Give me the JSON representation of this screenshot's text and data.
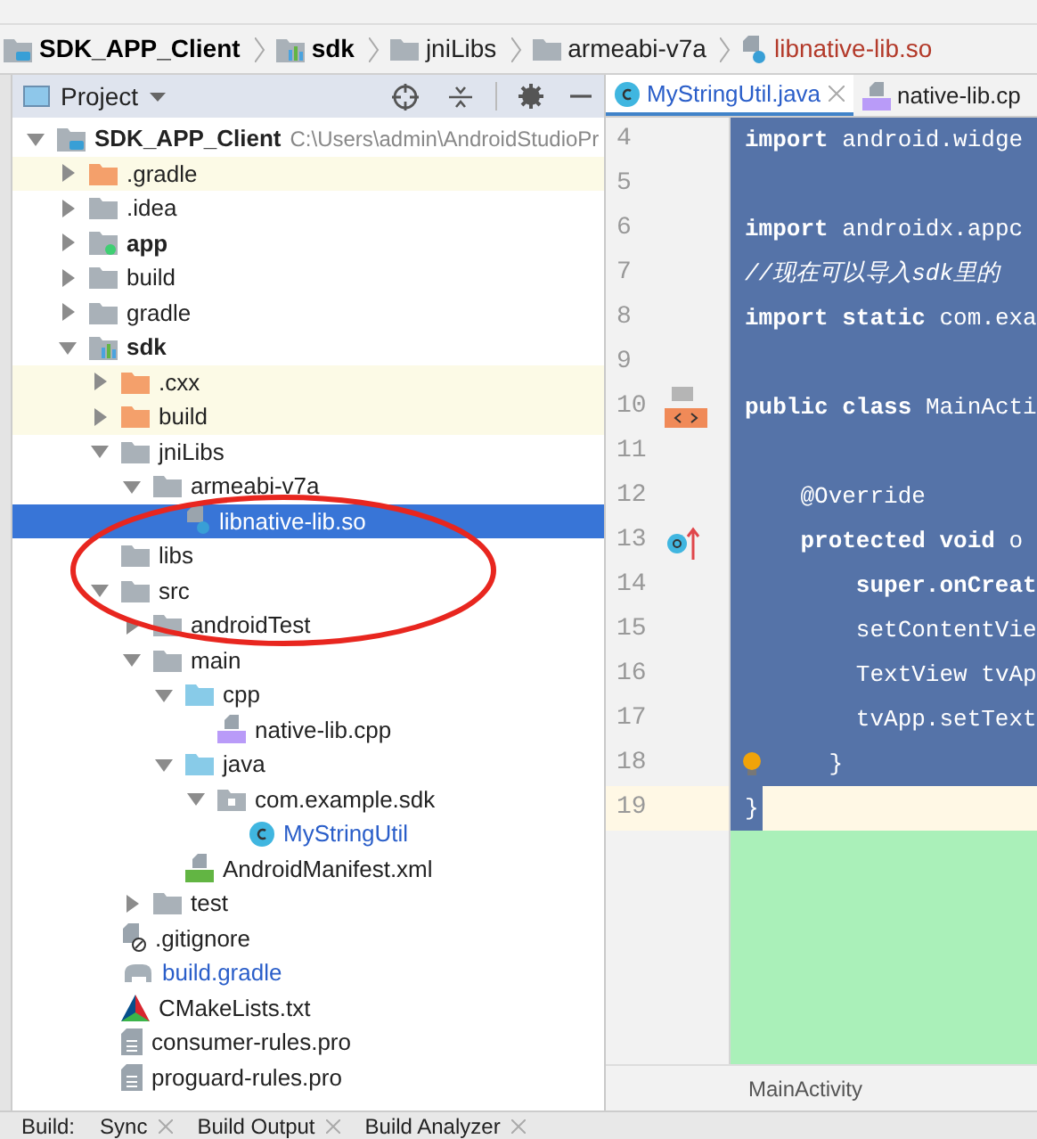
{
  "breadcrumb": [
    {
      "label": "SDK_APP_Client",
      "kind": "project"
    },
    {
      "label": "sdk",
      "kind": "module"
    },
    {
      "label": "jniLibs",
      "kind": "folder"
    },
    {
      "label": "armeabi-v7a",
      "kind": "folder"
    },
    {
      "label": "libnative-lib.so",
      "kind": "unknown"
    }
  ],
  "project_panel": {
    "title": "Project",
    "tree": [
      {
        "label": "SDK_APP_Client",
        "path": "C:\\Users\\admin\\AndroidStudioPr",
        "kind": "project",
        "expanded": true,
        "selected": false,
        "excluded": false,
        "children": [
          {
            "label": ".gradle",
            "kind": "folder-orange",
            "expanded": false,
            "selected": false,
            "excluded": true
          },
          {
            "label": ".idea",
            "kind": "folder",
            "expanded": false,
            "selected": false,
            "excluded": false
          },
          {
            "label": "app",
            "kind": "module-app",
            "expanded": false,
            "selected": false,
            "excluded": false
          },
          {
            "label": "build",
            "kind": "folder",
            "expanded": false,
            "selected": false,
            "excluded": false
          },
          {
            "label": "gradle",
            "kind": "folder",
            "expanded": false,
            "selected": false,
            "excluded": false
          },
          {
            "label": "sdk",
            "kind": "module",
            "expanded": true,
            "selected": false,
            "excluded": false,
            "children": [
              {
                "label": ".cxx",
                "kind": "folder-orange",
                "expanded": false,
                "selected": false,
                "excluded": true
              },
              {
                "label": "build",
                "kind": "folder-orange",
                "expanded": false,
                "selected": false,
                "excluded": true
              },
              {
                "label": "jniLibs",
                "kind": "folder",
                "expanded": true,
                "selected": false,
                "excluded": false,
                "children": [
                  {
                    "label": "armeabi-v7a",
                    "kind": "folder",
                    "expanded": true,
                    "selected": false,
                    "excluded": false,
                    "children": [
                      {
                        "label": "libnative-lib.so",
                        "kind": "unknown",
                        "selected": true
                      }
                    ]
                  }
                ]
              },
              {
                "label": "libs",
                "kind": "folder",
                "selected": false,
                "excluded": false
              },
              {
                "label": "src",
                "kind": "folder",
                "expanded": true,
                "selected": false,
                "excluded": false,
                "children": [
                  {
                    "label": "androidTest",
                    "kind": "folder",
                    "expanded": false,
                    "selected": false,
                    "excluded": false
                  },
                  {
                    "label": "main",
                    "kind": "folder",
                    "expanded": true,
                    "selected": false,
                    "excluded": false,
                    "children": [
                      {
                        "label": "cpp",
                        "kind": "folder-blue",
                        "expanded": true,
                        "selected": false,
                        "excluded": false,
                        "children": [
                          {
                            "label": "native-lib.cpp",
                            "kind": "cpp",
                            "selected": false,
                            "excluded": false
                          }
                        ]
                      },
                      {
                        "label": "java",
                        "kind": "folder-blue",
                        "expanded": true,
                        "selected": false,
                        "excluded": false,
                        "children": [
                          {
                            "label": "com.example.sdk",
                            "kind": "package",
                            "expanded": true,
                            "selected": false,
                            "excluded": false,
                            "children": [
                              {
                                "label": "MyStringUtil",
                                "kind": "class",
                                "modified": true,
                                "selected": false,
                                "excluded": false
                              }
                            ]
                          }
                        ]
                      },
                      {
                        "label": "AndroidManifest.xml",
                        "kind": "manifest",
                        "selected": false,
                        "excluded": false
                      }
                    ]
                  },
                  {
                    "label": "test",
                    "kind": "folder",
                    "expanded": false,
                    "selected": false,
                    "excluded": false
                  }
                ]
              },
              {
                "label": ".gitignore",
                "kind": "gitignore",
                "selected": false,
                "excluded": false
              },
              {
                "label": "build.gradle",
                "kind": "gradle",
                "modified": true,
                "selected": false,
                "excluded": false
              },
              {
                "label": "CMakeLists.txt",
                "kind": "cmake",
                "selected": false,
                "excluded": false
              },
              {
                "label": "consumer-rules.pro",
                "kind": "text",
                "selected": false,
                "excluded": false
              },
              {
                "label": "proguard-rules.pro",
                "kind": "text",
                "selected": false,
                "excluded": false
              }
            ]
          }
        ]
      }
    ]
  },
  "editor": {
    "tabs": [
      {
        "label": "MyStringUtil.java",
        "kind": "class",
        "selected": true
      },
      {
        "label": "native-lib.cp",
        "kind": "cpp",
        "selected": false
      }
    ],
    "lines": [
      {
        "number": "4",
        "code": "import android.widge",
        "selected": true,
        "current": false
      },
      {
        "number": "5",
        "selected": true,
        "current": false
      },
      {
        "number": "6",
        "code": "import androidx.appc",
        "selected": true,
        "current": false
      },
      {
        "number": "7",
        "code": "//现在可以导入sdk里的",
        "selected": true,
        "current": false,
        "comment": true
      },
      {
        "number": "8",
        "code": "import static com.exa",
        "selected": true,
        "current": false
      },
      {
        "number": "9",
        "selected": true,
        "current": false
      },
      {
        "number": "10",
        "code": "public class MainActi",
        "selected": true,
        "current": false,
        "kind": "class"
      },
      {
        "number": "11",
        "selected": true,
        "current": false
      },
      {
        "number": "12",
        "code": "    @Override",
        "selected": true,
        "current": false
      },
      {
        "number": "13",
        "code": "    protected void o",
        "selected": true,
        "current": false,
        "kind": "override"
      },
      {
        "number": "14",
        "code": "        super.onCreat",
        "selected": true,
        "current": false
      },
      {
        "number": "15",
        "code": "        setContentVie",
        "selected": true,
        "current": false
      },
      {
        "number": "16",
        "code": "        TextView tvAp",
        "selected": true,
        "current": false
      },
      {
        "number": "17",
        "code": "        tvApp.setText",
        "selected": true,
        "current": false
      },
      {
        "number": "18",
        "code": "    }",
        "selected": true,
        "current": false,
        "kind": "bulb"
      },
      {
        "number": "19",
        "code": "}",
        "selected": false,
        "current": true
      }
    ],
    "footer": "MainActivity"
  },
  "bottom_bar": {
    "label": "Build:",
    "tabs": [
      {
        "label": "Sync"
      },
      {
        "label": "Build Output"
      },
      {
        "label": "Build Analyzer"
      }
    ]
  }
}
